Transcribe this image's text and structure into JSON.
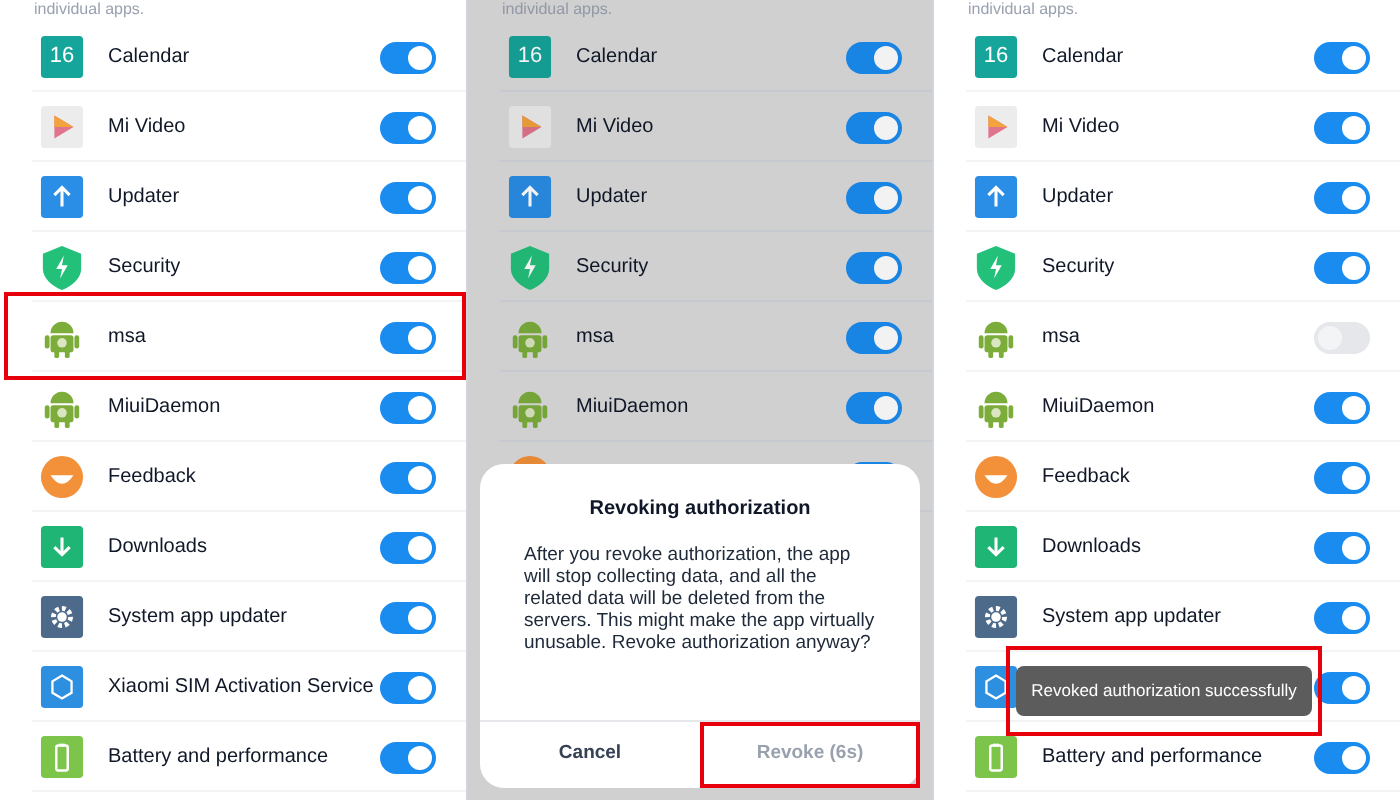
{
  "panels": [
    {
      "header": "individual apps.",
      "dimmed": false,
      "apps": [
        {
          "name": "Calendar",
          "kind": "calendar",
          "badge": "16",
          "on": true,
          "highlighted": false
        },
        {
          "name": "Mi Video",
          "kind": "video",
          "on": true,
          "highlighted": false
        },
        {
          "name": "Updater",
          "kind": "updater",
          "on": true,
          "highlighted": false
        },
        {
          "name": "Security",
          "kind": "shield",
          "on": true,
          "highlighted": false
        },
        {
          "name": "msa",
          "kind": "android",
          "on": true,
          "highlighted": true
        },
        {
          "name": "MiuiDaemon",
          "kind": "android",
          "on": true,
          "highlighted": false
        },
        {
          "name": "Feedback",
          "kind": "feedback",
          "on": true,
          "highlighted": false
        },
        {
          "name": "Downloads",
          "kind": "downloads",
          "on": true,
          "highlighted": false
        },
        {
          "name": "System app updater",
          "kind": "gear",
          "on": true,
          "highlighted": false
        },
        {
          "name": "Xiaomi SIM Activation Service",
          "kind": "sim",
          "on": true,
          "highlighted": false
        },
        {
          "name": "Battery and performance",
          "kind": "battery",
          "on": true,
          "highlighted": false
        }
      ]
    },
    {
      "header": "individual apps.",
      "dimmed": true,
      "apps": [
        {
          "name": "Calendar",
          "kind": "calendar",
          "badge": "16",
          "on": true,
          "highlighted": false
        },
        {
          "name": "Mi Video",
          "kind": "video",
          "on": true,
          "highlighted": false
        },
        {
          "name": "Updater",
          "kind": "updater",
          "on": true,
          "highlighted": false
        },
        {
          "name": "Security",
          "kind": "shield",
          "on": true,
          "highlighted": false
        },
        {
          "name": "msa",
          "kind": "android",
          "on": true,
          "highlighted": false
        },
        {
          "name": "MiuiDaemon",
          "kind": "android",
          "on": true,
          "highlighted": false
        },
        {
          "kind": "feedback",
          "on": true,
          "highlighted": false
        }
      ],
      "dialog": {
        "title": "Revoking authorization",
        "message": "After you revoke authorization, the app will stop collecting data, and all the related data will be deleted from the servers. This might make the app virtually unusable. Revoke authorization anyway?",
        "buttons": [
          {
            "label": "Cancel",
            "disabled": false,
            "highlighted": false
          },
          {
            "label": "Revoke (6s)",
            "disabled": true,
            "highlighted": true
          }
        ]
      }
    },
    {
      "header": "individual apps.",
      "dimmed": false,
      "apps": [
        {
          "name": "Calendar",
          "kind": "calendar",
          "badge": "16",
          "on": true,
          "highlighted": false
        },
        {
          "name": "Mi Video",
          "kind": "video",
          "on": true,
          "highlighted": false
        },
        {
          "name": "Updater",
          "kind": "updater",
          "on": true,
          "highlighted": false
        },
        {
          "name": "Security",
          "kind": "shield",
          "on": true,
          "highlighted": false
        },
        {
          "name": "msa",
          "kind": "android",
          "on": false,
          "highlighted": false
        },
        {
          "name": "MiuiDaemon",
          "kind": "android",
          "on": true,
          "highlighted": false
        },
        {
          "name": "Feedback",
          "kind": "feedback",
          "on": true,
          "highlighted": false
        },
        {
          "name": "Downloads",
          "kind": "downloads",
          "on": true,
          "highlighted": false
        },
        {
          "name": "System app updater",
          "kind": "gear",
          "on": true,
          "highlighted": false
        },
        {
          "kind": "sim",
          "on": true,
          "highlighted": false
        },
        {
          "name": "Battery and performance",
          "kind": "battery",
          "on": true,
          "highlighted": false
        }
      ],
      "toast": {
        "text": "Revoked authorization successfully",
        "highlighted": true
      }
    }
  ]
}
